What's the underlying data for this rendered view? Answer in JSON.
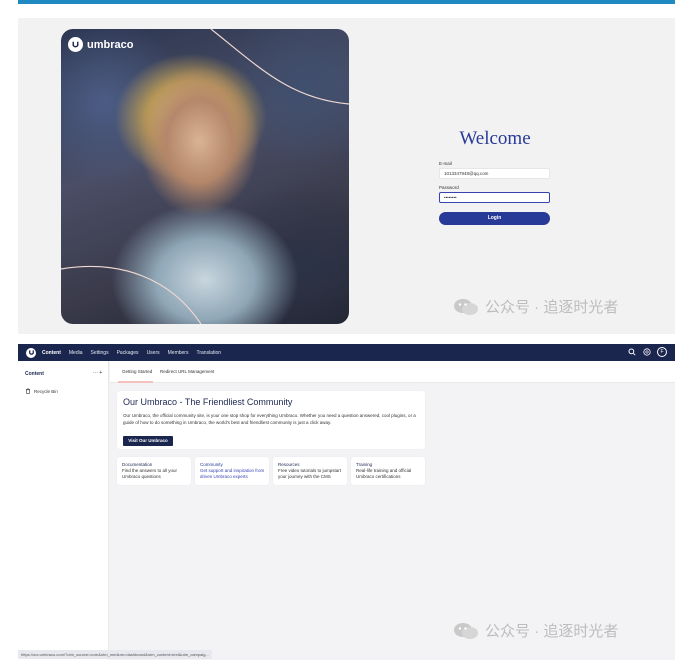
{
  "login": {
    "brand": "umbraco",
    "welcome": "Welcome",
    "email_label": "E-mail",
    "email_value": "1013347948@qq.com",
    "password_label": "Password",
    "password_value": "••••••••",
    "login_button": "Login"
  },
  "watermark": {
    "text": "公众号 · 追逐时光者"
  },
  "backoffice": {
    "nav": {
      "items": [
        "Content",
        "Media",
        "Settings",
        "Packages",
        "Users",
        "Members",
        "Translation"
      ],
      "active": "Content",
      "avatar_initial": "F"
    },
    "sidebar": {
      "title": "Content",
      "actions": "···  +",
      "recycle_bin": "Recycle Bin"
    },
    "tabs": [
      "Getting Started",
      "Redirect URL Management"
    ],
    "community_card": {
      "title": "Our Umbraco - The Friendliest Community",
      "description": "Our Umbraco, the official community site, is your one stop shop for everything Umbraco. Whether you need a question answered, cool plugins, or a guide of how to do something in Umbraco, the world's best and friendliest community is just a click away.",
      "button": "Visit Our Umbraco"
    },
    "mini_cards": [
      {
        "title": "Documentation",
        "text": "Find the answers to all your Umbraco questions"
      },
      {
        "title": "Community",
        "text": "Get support and inspiration from driven Umbraco experts"
      },
      {
        "title": "Resources",
        "text": "Free video tutorials to jumpstart your journey with the CMS"
      },
      {
        "title": "Training",
        "text": "Real-life training and official Umbraco certifications"
      }
    ],
    "status_url": "https://our.umbraco.com/?utm_source=core&utm_medium=dashboard&utm_content=text&utm_campaig..."
  },
  "colors": {
    "accent_top": "#1f8ac2",
    "brand_blue": "#283a97",
    "nav_bg": "#1b264f"
  }
}
